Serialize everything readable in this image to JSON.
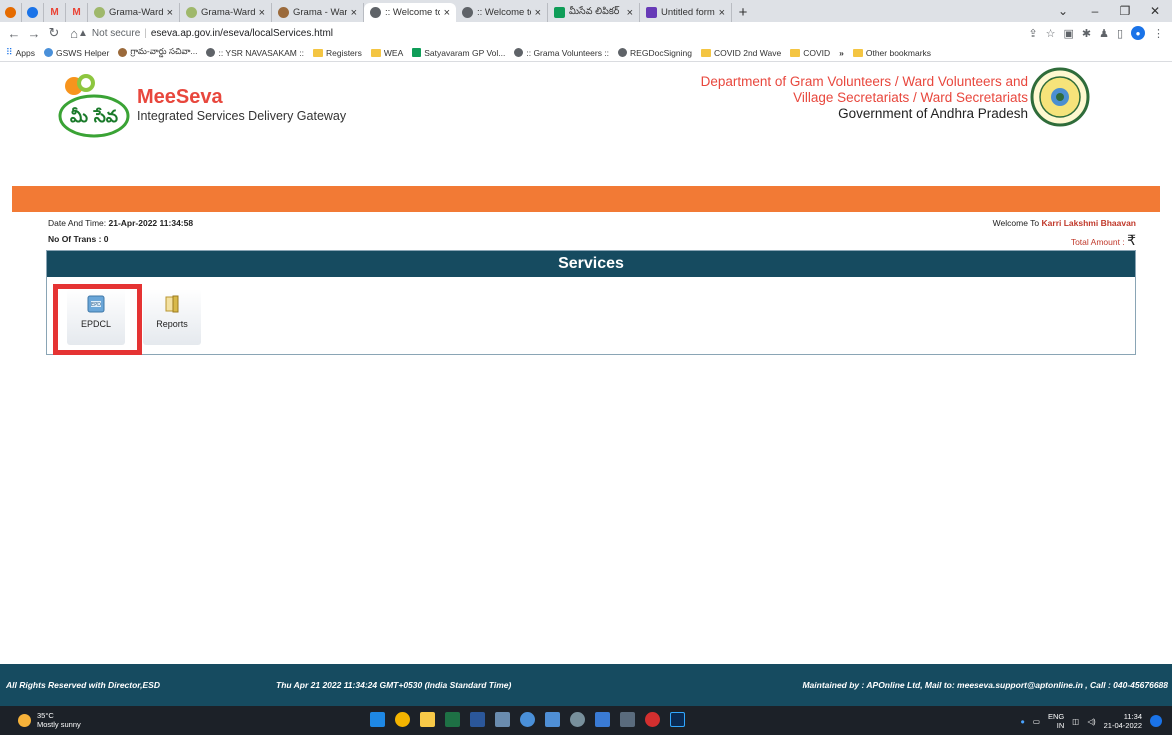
{
  "browser": {
    "tabs": [
      {
        "label": "",
        "fav": "#e56b00",
        "type": "small"
      },
      {
        "label": "",
        "fav": "#1a73e8",
        "type": "small"
      },
      {
        "label": "M",
        "fav": "#ea4335",
        "type": "small"
      },
      {
        "label": "M",
        "fav": "#ea4335",
        "type": "small"
      },
      {
        "label": "Grama-Ward S",
        "fav": "#9fb86b"
      },
      {
        "label": "Grama-Ward S",
        "fav": "#9fb86b"
      },
      {
        "label": "Grama - Ward",
        "fav": "#9b6a3b"
      },
      {
        "label": ":: Welcome to",
        "fav": "#5f6368",
        "active": true
      },
      {
        "label": ":: Welcome to",
        "fav": "#5f6368"
      },
      {
        "label": "మీసేవ లిపికర్",
        "fav": "#0f9d58"
      },
      {
        "label": "Untitled form",
        "fav": "#673ab7"
      }
    ],
    "not_secure": "Not secure",
    "url": "eseva.ap.gov.in/eseva/localServices.html",
    "bookmarks": [
      "Apps",
      "GSWS Helper",
      "గ్రామ-వార్డు సచివా...",
      ":: YSR NAVASAKAM ::",
      "Registers",
      "WEA",
      "Satyavaram GP Vol...",
      ":: Grama Volunteers ::",
      "REGDocSigning",
      "COVID 2nd Wave",
      "COVID",
      "»",
      "Other bookmarks"
    ]
  },
  "header": {
    "logo_text": "మీ సేవ",
    "brand_name": "MeeSeva",
    "brand_tagline": "Integrated Services Delivery Gateway",
    "dept_line1": "Department of Gram Volunteers / Ward Volunteers and",
    "dept_line2": "Village Secretariats / Ward Secretariats",
    "dept_line3": "Government of Andhra Pradesh"
  },
  "info": {
    "datetime_label": "Date And Time:",
    "datetime_value": "21-Apr-2022 11:34:58",
    "trans_label": "No Of Trans",
    "trans_value": ": 0",
    "welcome_label": "Welcome To",
    "welcome_name": "Karri Lakshmi Bhaavan",
    "total_label": "Total Amount :",
    "total_symbol": "₹"
  },
  "services": {
    "title": "Services",
    "tiles": [
      {
        "label": "EPDCL",
        "icon": "epdcl-icon",
        "highlighted": true
      },
      {
        "label": "Reports",
        "icon": "reports-icon"
      }
    ]
  },
  "footer": {
    "left": "All Rights Reserved with Director,ESD",
    "center": "Thu Apr 21 2022 11:34:24 GMT+0530 (India Standard Time)",
    "right": "Maintained by : APOnline Ltd, Mail to: meeseva.support@aptonline.in , Call : 040-45676688"
  },
  "taskbar": {
    "temp": "35°C",
    "weather": "Mostly sunny",
    "lang1": "ENG",
    "lang2": "IN",
    "time": "11:34",
    "date": "21-04-2022"
  },
  "colors": {
    "accent_orange": "#f27a35",
    "panel_teal": "#164b60",
    "brand_red": "#e8473d",
    "highlight_red": "#e53333"
  }
}
